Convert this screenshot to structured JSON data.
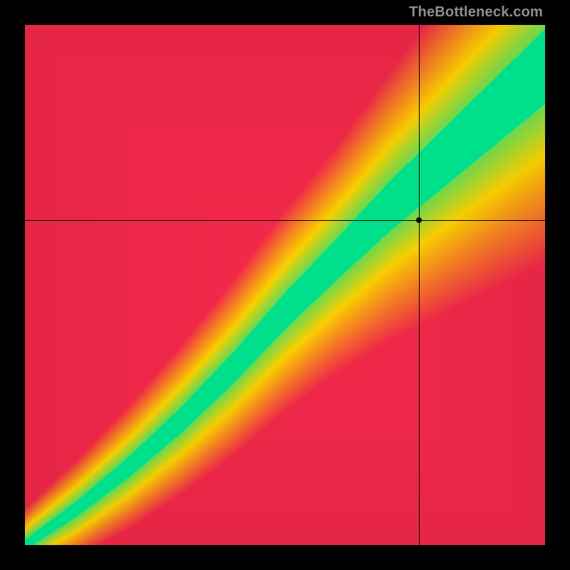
{
  "watermark": "TheBottleneck.com",
  "chart_data": {
    "type": "heatmap",
    "title": "",
    "xlabel": "",
    "ylabel": "",
    "xlim": [
      0,
      1
    ],
    "ylim": [
      0,
      1
    ],
    "color_scale": {
      "low": "#ff2a4d",
      "mid": "#ffd400",
      "high": "#00e08a",
      "description": "Red far from optimal, yellow transitional, green optimal balance"
    },
    "optimal_curve_description": "Green band follows a superlinear diagonal from bottom-left to top-right; band widens at higher x/y.",
    "crosshair": {
      "x": 0.757,
      "y": 0.625
    },
    "marker": {
      "x": 0.757,
      "y": 0.625
    },
    "sample_curve_points": [
      {
        "x": 0.0,
        "y_center": 0.0,
        "band_halfwidth": 0.01
      },
      {
        "x": 0.1,
        "y_center": 0.07,
        "band_halfwidth": 0.015
      },
      {
        "x": 0.2,
        "y_center": 0.15,
        "band_halfwidth": 0.02
      },
      {
        "x": 0.3,
        "y_center": 0.24,
        "band_halfwidth": 0.025
      },
      {
        "x": 0.4,
        "y_center": 0.34,
        "band_halfwidth": 0.03
      },
      {
        "x": 0.5,
        "y_center": 0.45,
        "band_halfwidth": 0.035
      },
      {
        "x": 0.6,
        "y_center": 0.55,
        "band_halfwidth": 0.04
      },
      {
        "x": 0.7,
        "y_center": 0.65,
        "band_halfwidth": 0.048
      },
      {
        "x": 0.8,
        "y_center": 0.74,
        "band_halfwidth": 0.056
      },
      {
        "x": 0.9,
        "y_center": 0.83,
        "band_halfwidth": 0.064
      },
      {
        "x": 1.0,
        "y_center": 0.92,
        "band_halfwidth": 0.072
      }
    ]
  }
}
